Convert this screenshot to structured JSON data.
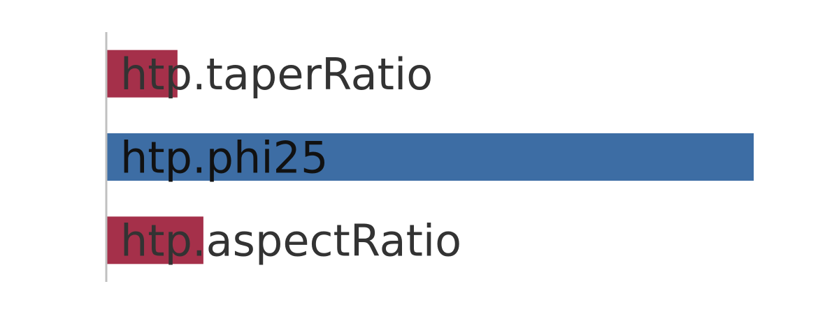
{
  "chart_data": {
    "type": "bar",
    "orientation": "horizontal",
    "title": "",
    "xlabel": "",
    "ylabel": "",
    "categories": [
      "htp.taperRatio",
      "htp.phi25",
      "htp.aspectRatio"
    ],
    "values": [
      0.11,
      1.0,
      0.15
    ],
    "colors": [
      "#a5304a",
      "#3d6da4",
      "#a5304a"
    ],
    "xlim": [
      0,
      1.0
    ],
    "grid": false,
    "legend": "none"
  },
  "colors": {
    "axis": "#c0c0c0",
    "label_text": "#333333",
    "label_text_on_bar": "#111111"
  }
}
